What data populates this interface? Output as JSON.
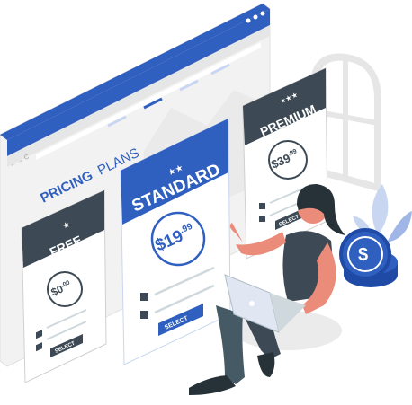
{
  "illustration": {
    "heading_bold": "PRICING",
    "heading_light": "PLANS",
    "colors": {
      "primary": "#2f5fbf",
      "dark": "#263238",
      "light_bg": "#ebebeb",
      "skin": "#eb8c7a"
    }
  },
  "plans": [
    {
      "name": "FREE",
      "price_main": "$0",
      "price_cents": ".00",
      "button": "SELECT"
    },
    {
      "name": "STANDARD",
      "price_main": "$19",
      "price_cents": ".99",
      "button": "SELECT"
    },
    {
      "name": "PREMIUM",
      "price_main": "$39",
      "price_cents": ".99",
      "button": "SELECT"
    }
  ],
  "icons": [
    "star-icon",
    "dollar-coin-icon",
    "laptop-icon",
    "window-arch-icon",
    "leaf-icon"
  ]
}
